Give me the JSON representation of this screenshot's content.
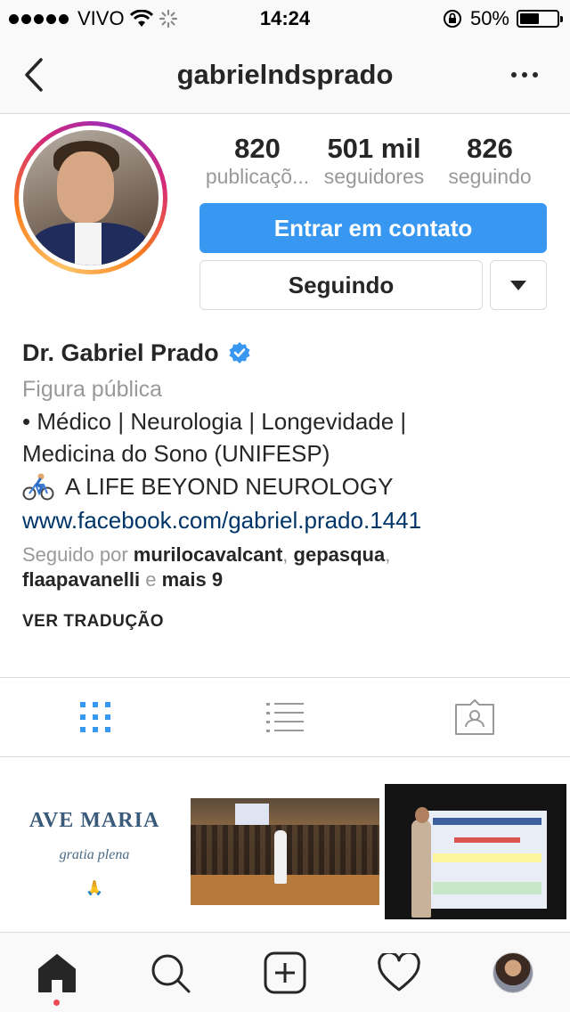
{
  "status_bar": {
    "carrier": "VIVO",
    "time": "14:24",
    "battery": "50%",
    "battery_level": 0.5
  },
  "nav": {
    "title": "gabrielndsprado",
    "back_icon": "chevron-left-icon",
    "more_icon": "ellipsis-icon"
  },
  "profile": {
    "stats": [
      {
        "value": "820",
        "label": "publicaçõ..."
      },
      {
        "value": "501 mil",
        "label": "seguidores"
      },
      {
        "value": "826",
        "label": "seguindo"
      }
    ],
    "contact_button": "Entrar em contato",
    "following_button": "Seguindo"
  },
  "bio": {
    "name": "Dr. Gabriel Prado",
    "category": "Figura pública",
    "line1": "• Médico | Neurologia | Longevidade |",
    "line2": "Medicina do Sono (UNIFESP)",
    "tagline": "A LIFE BEYOND NEUROLOGY",
    "link": "www.facebook.com/gabriel.prado.1441",
    "followed_by_prefix": "Seguido por",
    "followed_by_users": [
      "murilocavalcant",
      "gepasqua",
      "flaapavanelli"
    ],
    "followed_by_and": "e",
    "followed_by_more": "mais 9",
    "translate": "VER TRADUÇÃO"
  },
  "posts": {
    "tile1_title": "AVE MARIA",
    "tile1_subtitle": "gratia plena"
  },
  "colors": {
    "accent": "#3897f0",
    "link": "#003569",
    "verified": "#3897f0",
    "notification": "#ed4956"
  }
}
